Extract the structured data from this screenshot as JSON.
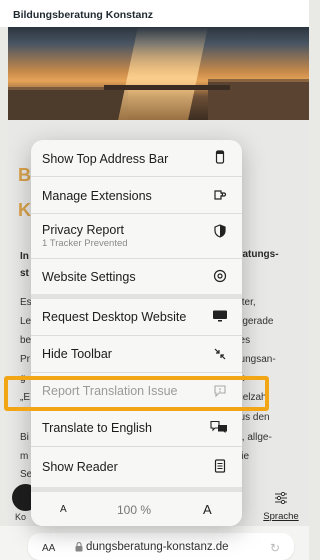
{
  "site": {
    "title": "Bildungsberatung Konstanz",
    "fragments": {
      "heading_b": "B",
      "heading_k": "K",
      "intro_left": "In",
      "intro_right": "eratungs-",
      "st": "st",
      "left_lines": [
        "Es",
        "Le",
        "be",
        "Pr",
        "g",
        "„E",
        "",
        "Bi",
        "m",
        "Se"
      ],
      "right_lines": [
        "alter,",
        "h gerade",
        "nes",
        "dungsan-",
        "nk",
        "Vielzahl",
        "aus den",
        "le, allge-",
        "wie"
      ],
      "ko": "Ko"
    },
    "sprache_label": "Sprache"
  },
  "menu": {
    "items": [
      {
        "label": "Show Top Address Bar",
        "icon": "phone-top-bar-icon"
      },
      {
        "label": "Manage Extensions",
        "icon": "extensions-icon"
      },
      {
        "label": "Privacy Report",
        "sublabel": "1 Tracker Prevented",
        "icon": "privacy-shield-icon"
      },
      {
        "label": "Website Settings",
        "icon": "settings-gear-icon"
      },
      {
        "label": "Request Desktop Website",
        "icon": "desktop-icon"
      },
      {
        "label": "Hide Toolbar",
        "icon": "collapse-arrows-icon"
      },
      {
        "label": "Report Translation Issue",
        "icon": "report-bubble-icon",
        "disabled": true
      },
      {
        "label": "Translate to English",
        "icon": "translate-icon"
      },
      {
        "label": "Show Reader",
        "icon": "reader-icon"
      }
    ],
    "zoom": {
      "smaller": "A",
      "level": "100 %",
      "larger": "A"
    }
  },
  "toolbar": {
    "aa_label": "AA",
    "url": "dungsberatung-konstanz.de"
  },
  "colors": {
    "highlight": "#f2a515",
    "accent": "#d9a24a"
  }
}
